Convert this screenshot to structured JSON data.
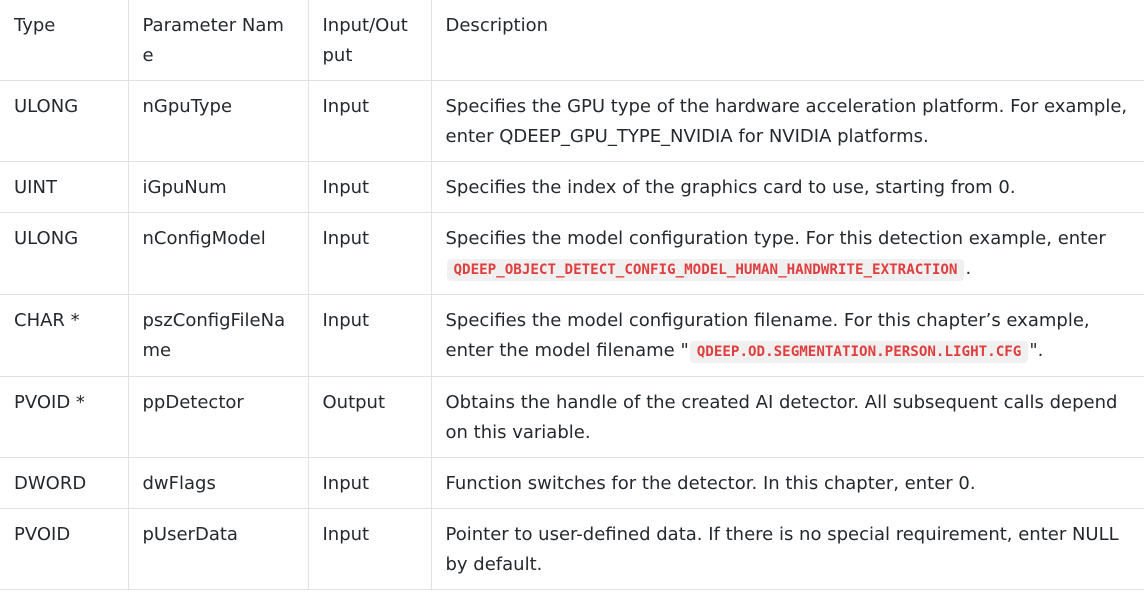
{
  "table": {
    "headers": [
      "Type",
      "Parameter Name",
      "Input/Output",
      "Description"
    ],
    "rows": [
      {
        "type": "ULONG",
        "name": "nGpuType",
        "io": "Input",
        "desc": {
          "before": "Specifies the GPU type of the hardware acceleration platform. For example, enter QDEEP_GPU_TYPE_NVIDIA for NVIDIA platforms.",
          "code": "",
          "after": ""
        }
      },
      {
        "type": "UINT",
        "name": "iGpuNum",
        "io": "Input",
        "desc": {
          "before": "Specifies the index of the graphics card to use, starting from 0.",
          "code": "",
          "after": ""
        }
      },
      {
        "type": "ULONG",
        "name": "nConfigModel",
        "io": "Input",
        "desc": {
          "before": "Specifies the model configuration type. For this detection example, enter ",
          "code": "QDEEP_OBJECT_DETECT_CONFIG_MODEL_HUMAN_HANDWRITE_EXTRACTION",
          "after": "."
        }
      },
      {
        "type": "CHAR *",
        "name": "pszConfigFileName",
        "io": "Input",
        "desc": {
          "before": "Specifies the model configuration filename. For this chapter’s example, enter the model filename \"",
          "code": "QDEEP.OD.SEGMENTATION.PERSON.LIGHT.CFG",
          "after": "\"."
        }
      },
      {
        "type": "PVOID *",
        "name": "ppDetector",
        "io": "Output",
        "desc": {
          "before": "Obtains the handle of the created AI detector. All subsequent calls depend on this variable.",
          "code": "",
          "after": ""
        }
      },
      {
        "type": "DWORD",
        "name": "dwFlags",
        "io": "Input",
        "desc": {
          "before": "Function switches for the detector. In this chapter, enter 0.",
          "code": "",
          "after": ""
        }
      },
      {
        "type": "PVOID",
        "name": "pUserData",
        "io": "Input",
        "desc": {
          "before": "Pointer to user-defined data. If there is no special requirement, enter NULL by default.",
          "code": "",
          "after": ""
        }
      }
    ]
  }
}
